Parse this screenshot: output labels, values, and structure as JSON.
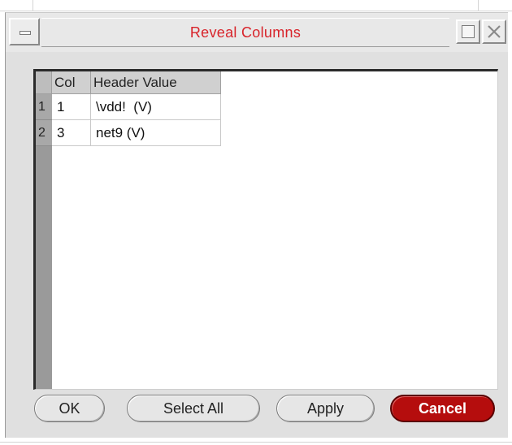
{
  "window": {
    "title": "Reveal Columns"
  },
  "table": {
    "columns": [
      "Col",
      "Header Value"
    ],
    "rows": [
      {
        "num": "1",
        "col": "1",
        "value": "\\vdd!  (V)"
      },
      {
        "num": "2",
        "col": "3",
        "value": "net9 (V)"
      }
    ]
  },
  "buttons": {
    "ok": "OK",
    "select_all": "Select All",
    "apply": "Apply",
    "cancel": "Cancel"
  },
  "colors": {
    "title_text": "#d8232a",
    "cancel_bg": "#b50d0d"
  },
  "icons": {
    "window_menu": "window-menu-icon",
    "maximize": "maximize-icon",
    "close": "close-icon"
  }
}
